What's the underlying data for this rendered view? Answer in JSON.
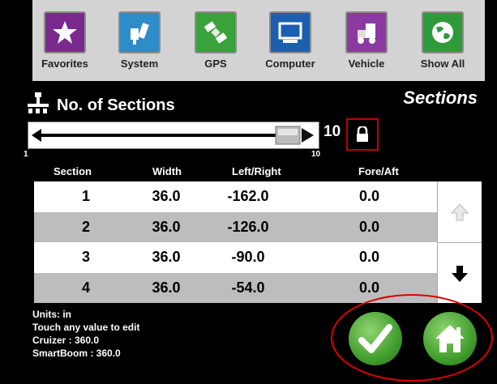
{
  "toolbar": {
    "items": [
      {
        "label": "Favorites",
        "icon": "star-icon",
        "color": "#7a2a8c"
      },
      {
        "label": "System",
        "icon": "system-tools-icon",
        "color": "#2e8cc8"
      },
      {
        "label": "GPS",
        "icon": "satellite-icon",
        "color": "#3aa23a"
      },
      {
        "label": "Computer",
        "icon": "computer-icon",
        "color": "#1c5fb0"
      },
      {
        "label": "Vehicle",
        "icon": "vehicle-icon",
        "color": "#8a3aa0"
      },
      {
        "label": "Show All",
        "icon": "globe-icon",
        "color": "#2f9a3a"
      }
    ]
  },
  "page": {
    "title": "Sections"
  },
  "sections_control": {
    "label": "No. of Sections",
    "value": "10",
    "min_label": "1",
    "max_label": "10"
  },
  "table": {
    "headers": [
      "Section",
      "Width",
      "Left/Right",
      "Fore/Aft"
    ],
    "rows": [
      [
        "1",
        "36.0",
        "-162.0",
        "0.0"
      ],
      [
        "2",
        "36.0",
        "-126.0",
        "0.0"
      ],
      [
        "3",
        "36.0",
        "-90.0",
        "0.0"
      ],
      [
        "4",
        "36.0",
        "-54.0",
        "0.0"
      ]
    ]
  },
  "info": {
    "units": "Units: in",
    "hint": "Touch any value to edit",
    "cruizer": "Cruizer : 360.0",
    "smartboom": "SmartBoom : 360.0"
  },
  "colors": {
    "accent_green": "#4caf3a",
    "highlight_red": "#e00000",
    "lock_border": "#c00000"
  }
}
